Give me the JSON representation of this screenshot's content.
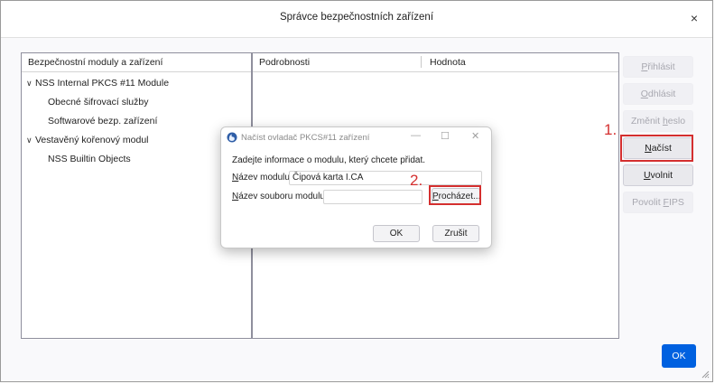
{
  "window": {
    "title": "Správce bezpečnostních zařízení",
    "close_glyph": "×",
    "ok_label": "OK"
  },
  "tree": {
    "header": "Bezpečnostní moduly a zařízení",
    "items": [
      {
        "label": "NSS Internal PKCS #11 Module",
        "expanded": true
      },
      {
        "label": "Obecné šifrovací služby"
      },
      {
        "label": "Softwarové bezp. zařízení"
      },
      {
        "label": "Vestavěný kořenový modul",
        "expanded": true
      },
      {
        "label": "NSS Builtin Objects"
      }
    ]
  },
  "details": {
    "col_details": "Podrobnosti",
    "col_value": "Hodnota"
  },
  "side_buttons": [
    {
      "pre": "",
      "key": "P",
      "post": "řihlásit",
      "enabled": false
    },
    {
      "pre": "",
      "key": "O",
      "post": "dhlásit",
      "enabled": false
    },
    {
      "pre": "Změnit ",
      "key": "h",
      "post": "eslo",
      "enabled": false
    },
    {
      "pre": "",
      "key": "N",
      "post": "ačíst",
      "enabled": true
    },
    {
      "pre": "",
      "key": "U",
      "post": "volnit",
      "enabled": true
    },
    {
      "pre": "Povolit ",
      "key": "F",
      "post": "IPS",
      "enabled": false
    }
  ],
  "annotations": {
    "step1": "1.",
    "step2": "2."
  },
  "dialog": {
    "title": "Načíst ovladač PKCS#11 zařízení",
    "minimize_glyph": "—",
    "maximize_glyph": "☐",
    "close_glyph": "✕",
    "info": "Zadejte informace o modulu, který chcete přidat.",
    "module_name_label_key": "N",
    "module_name_label_rest": "ázev modulu",
    "module_name_value": "Čipová karta I.CA",
    "module_file_label_key": "N",
    "module_file_label_rest": "ázev souboru modulu",
    "module_file_value": "",
    "browse_key": "P",
    "browse_rest": "rocházet...",
    "ok_label": "OK",
    "cancel_label": "Zrušit"
  },
  "colors": {
    "accent": "#0061e0",
    "annotation": "#d42f2f"
  }
}
